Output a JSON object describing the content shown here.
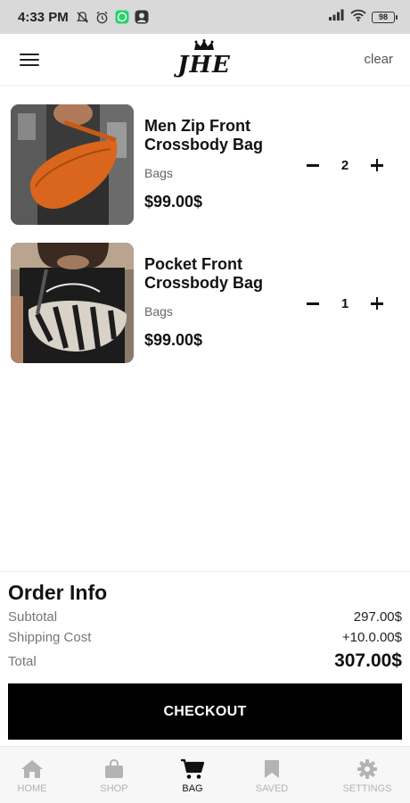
{
  "status_bar": {
    "time": "4:33 PM",
    "battery": "98",
    "icons": [
      "notifications-off-icon",
      "alarm-icon",
      "whatsapp-icon",
      "profile-icon",
      "signal-icon",
      "wifi-icon",
      "battery-icon"
    ]
  },
  "header": {
    "logo_text": "JHE",
    "clear_label": "clear",
    "menu_icon": "hamburger-menu-icon"
  },
  "cart": {
    "items": [
      {
        "title": "Men Zip Front Crossbody Bag",
        "category": "Bags",
        "price": "$99.00$",
        "quantity": "2",
        "image_color": "#d9661c"
      },
      {
        "title": "Pocket Front Crossbody Bag",
        "category": "Bags",
        "price": "$99.00$",
        "quantity": "1",
        "image_color": "#2b2b2b"
      }
    ]
  },
  "order_info": {
    "title": "Order Info",
    "subtotal_label": "Subtotal",
    "subtotal_value": "297.00$",
    "shipping_label": "Shipping Cost",
    "shipping_value": "+10.0.00$",
    "total_label": "Total",
    "total_value": "307.00$",
    "checkout_label": "CHECKOUT"
  },
  "bottom_nav": {
    "items": [
      {
        "label": "HOME",
        "icon": "home-icon",
        "active": false
      },
      {
        "label": "SHOP",
        "icon": "shopping-bag-icon",
        "active": false
      },
      {
        "label": "BAG",
        "icon": "cart-icon",
        "active": true
      },
      {
        "label": "SAVED",
        "icon": "bookmark-icon",
        "active": false
      },
      {
        "label": "SETTINGS",
        "icon": "gear-icon",
        "active": false
      }
    ]
  },
  "colors": {
    "accent": "#000000",
    "status_bar_bg": "#d9d9d9",
    "nav_inactive": "#b3b3b3"
  }
}
